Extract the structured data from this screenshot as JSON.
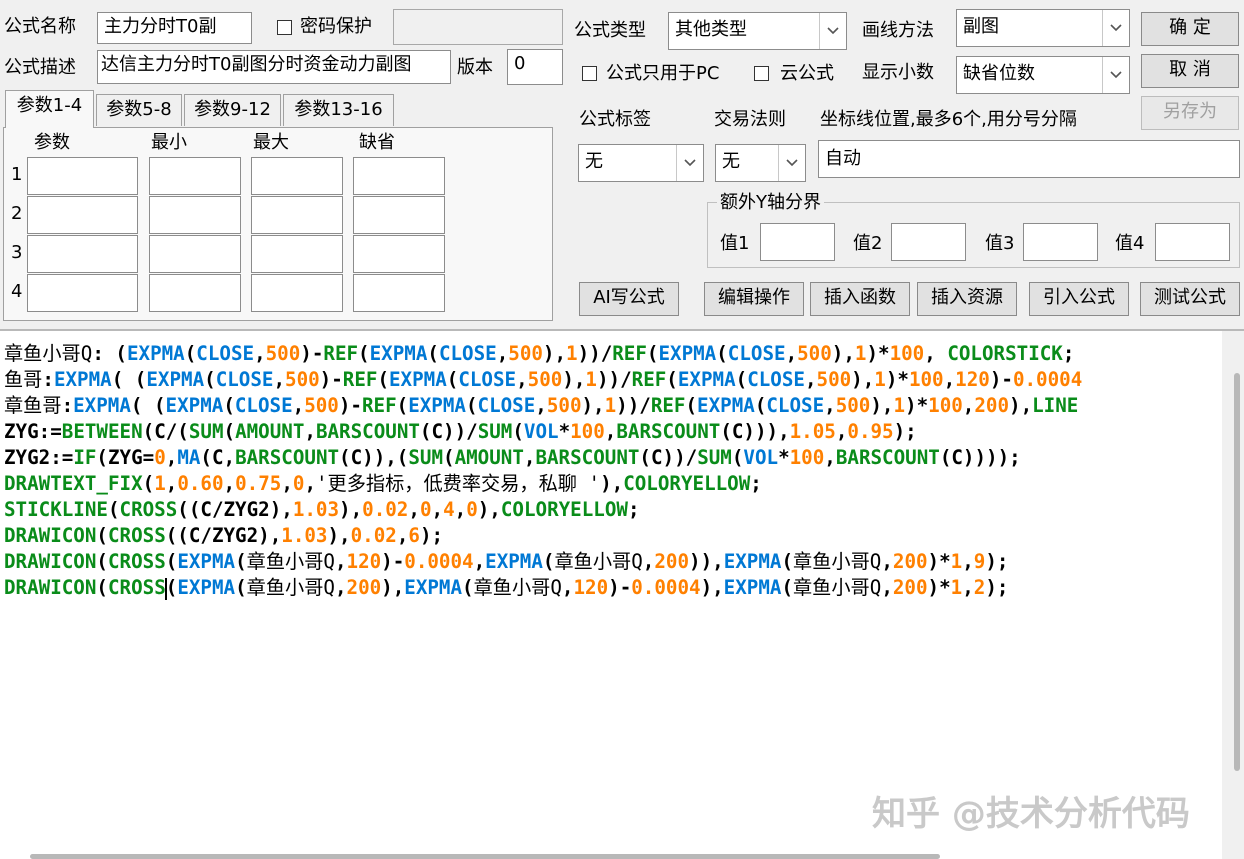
{
  "formula_name": {
    "label": "公式名称",
    "value": "主力分时T0副"
  },
  "password": {
    "label": "密码保护",
    "checked": false,
    "value": ""
  },
  "formula_desc": {
    "label": "公式描述",
    "value": "达信主力分时T0副图分时资金动力副图"
  },
  "version": {
    "label": "版本",
    "value": "0"
  },
  "formula_type": {
    "label": "公式类型",
    "value": "其他类型"
  },
  "draw_method": {
    "label": "画线方法",
    "value": "副图"
  },
  "pc_only": {
    "label": "公式只用于PC",
    "checked": false
  },
  "cloud": {
    "label": "云公式",
    "checked": false
  },
  "decimals": {
    "label": "显示小数",
    "value": "缺省位数"
  },
  "buttons": {
    "ok": "确  定",
    "cancel": "取  消",
    "save_as": "另存为"
  },
  "tabs": [
    "参数1-4",
    "参数5-8",
    "参数9-12",
    "参数13-16"
  ],
  "param_headers": [
    "参数",
    "最小",
    "最大",
    "缺省"
  ],
  "param_rows": [
    "1",
    "2",
    "3",
    "4"
  ],
  "formula_tag": {
    "label": "公式标签",
    "value": "无"
  },
  "trade_rule": {
    "label": "交易法则",
    "value": "无"
  },
  "axis_pos": {
    "label": "坐标线位置,最多6个,用分号分隔",
    "value": "自动"
  },
  "extra_y": {
    "label": "额外Y轴分界",
    "v1": "值1",
    "v2": "值2",
    "v3": "值3",
    "v4": "值4"
  },
  "actions": [
    "AI写公式",
    "编辑操作",
    "插入函数",
    "插入资源",
    "引入公式",
    "测试公式"
  ],
  "watermark": "知乎 @技术分析代码",
  "code_lines": [
    [
      [
        "c-name",
        "章鱼小哥Q"
      ],
      [
        "c-op",
        ": ("
      ],
      [
        "c-fn",
        "EXPMA"
      ],
      [
        "c-op",
        "("
      ],
      [
        "c-fn",
        "CLOSE"
      ],
      [
        "c-op",
        ","
      ],
      [
        "c-num",
        "500"
      ],
      [
        "c-op",
        ")-"
      ],
      [
        "c-kw",
        "REF"
      ],
      [
        "c-op",
        "("
      ],
      [
        "c-fn",
        "EXPMA"
      ],
      [
        "c-op",
        "("
      ],
      [
        "c-fn",
        "CLOSE"
      ],
      [
        "c-op",
        ","
      ],
      [
        "c-num",
        "500"
      ],
      [
        "c-op",
        "),"
      ],
      [
        "c-num",
        "1"
      ],
      [
        "c-op",
        "))/"
      ],
      [
        "c-kw",
        "REF"
      ],
      [
        "c-op",
        "("
      ],
      [
        "c-fn",
        "EXPMA"
      ],
      [
        "c-op",
        "("
      ],
      [
        "c-fn",
        "CLOSE"
      ],
      [
        "c-op",
        ","
      ],
      [
        "c-num",
        "500"
      ],
      [
        "c-op",
        "),"
      ],
      [
        "c-num",
        "1"
      ],
      [
        "c-op",
        ")*"
      ],
      [
        "c-num",
        "100"
      ],
      [
        "c-op",
        ", "
      ],
      [
        "c-kw",
        "COLORSTICK"
      ],
      [
        "c-op",
        ";"
      ]
    ],
    [
      [
        "c-name",
        "鱼哥"
      ],
      [
        "c-op",
        ":"
      ],
      [
        "c-fn",
        "EXPMA"
      ],
      [
        "c-op",
        "( ("
      ],
      [
        "c-fn",
        "EXPMA"
      ],
      [
        "c-op",
        "("
      ],
      [
        "c-fn",
        "CLOSE"
      ],
      [
        "c-op",
        ","
      ],
      [
        "c-num",
        "500"
      ],
      [
        "c-op",
        ")-"
      ],
      [
        "c-kw",
        "REF"
      ],
      [
        "c-op",
        "("
      ],
      [
        "c-fn",
        "EXPMA"
      ],
      [
        "c-op",
        "("
      ],
      [
        "c-fn",
        "CLOSE"
      ],
      [
        "c-op",
        ","
      ],
      [
        "c-num",
        "500"
      ],
      [
        "c-op",
        "),"
      ],
      [
        "c-num",
        "1"
      ],
      [
        "c-op",
        "))/"
      ],
      [
        "c-kw",
        "REF"
      ],
      [
        "c-op",
        "("
      ],
      [
        "c-fn",
        "EXPMA"
      ],
      [
        "c-op",
        "("
      ],
      [
        "c-fn",
        "CLOSE"
      ],
      [
        "c-op",
        ","
      ],
      [
        "c-num",
        "500"
      ],
      [
        "c-op",
        "),"
      ],
      [
        "c-num",
        "1"
      ],
      [
        "c-op",
        ")*"
      ],
      [
        "c-num",
        "100"
      ],
      [
        "c-op",
        ","
      ],
      [
        "c-num",
        "120"
      ],
      [
        "c-op",
        ")-"
      ],
      [
        "c-num",
        "0.0004"
      ]
    ],
    [
      [
        "c-name",
        "章鱼哥"
      ],
      [
        "c-op",
        ":"
      ],
      [
        "c-fn",
        "EXPMA"
      ],
      [
        "c-op",
        "( ("
      ],
      [
        "c-fn",
        "EXPMA"
      ],
      [
        "c-op",
        "("
      ],
      [
        "c-fn",
        "CLOSE"
      ],
      [
        "c-op",
        ","
      ],
      [
        "c-num",
        "500"
      ],
      [
        "c-op",
        ")-"
      ],
      [
        "c-kw",
        "REF"
      ],
      [
        "c-op",
        "("
      ],
      [
        "c-fn",
        "EXPMA"
      ],
      [
        "c-op",
        "("
      ],
      [
        "c-fn",
        "CLOSE"
      ],
      [
        "c-op",
        ","
      ],
      [
        "c-num",
        "500"
      ],
      [
        "c-op",
        "),"
      ],
      [
        "c-num",
        "1"
      ],
      [
        "c-op",
        "))/"
      ],
      [
        "c-kw",
        "REF"
      ],
      [
        "c-op",
        "("
      ],
      [
        "c-fn",
        "EXPMA"
      ],
      [
        "c-op",
        "("
      ],
      [
        "c-fn",
        "CLOSE"
      ],
      [
        "c-op",
        ","
      ],
      [
        "c-num",
        "500"
      ],
      [
        "c-op",
        "),"
      ],
      [
        "c-num",
        "1"
      ],
      [
        "c-op",
        ")*"
      ],
      [
        "c-num",
        "100"
      ],
      [
        "c-op",
        ","
      ],
      [
        "c-num",
        "200"
      ],
      [
        "c-op",
        "),"
      ],
      [
        "c-kw",
        "LINE"
      ]
    ],
    [
      [
        "c-op",
        "ZYG:="
      ],
      [
        "c-kw",
        "BETWEEN"
      ],
      [
        "c-op",
        "(C/("
      ],
      [
        "c-kw",
        "SUM"
      ],
      [
        "c-op",
        "("
      ],
      [
        "c-kw",
        "AMOUNT"
      ],
      [
        "c-op",
        ","
      ],
      [
        "c-kw",
        "BARSCOUNT"
      ],
      [
        "c-op",
        "(C))/"
      ],
      [
        "c-kw",
        "SUM"
      ],
      [
        "c-op",
        "("
      ],
      [
        "c-fn",
        "VOL"
      ],
      [
        "c-op",
        "*"
      ],
      [
        "c-num",
        "100"
      ],
      [
        "c-op",
        ","
      ],
      [
        "c-kw",
        "BARSCOUNT"
      ],
      [
        "c-op",
        "(C))),"
      ],
      [
        "c-num",
        "1.05"
      ],
      [
        "c-op",
        ","
      ],
      [
        "c-num",
        "0.95"
      ],
      [
        "c-op",
        ");"
      ]
    ],
    [
      [
        "c-op",
        "ZYG2:="
      ],
      [
        "c-kw",
        "IF"
      ],
      [
        "c-op",
        "(ZYG="
      ],
      [
        "c-num",
        "0"
      ],
      [
        "c-op",
        ","
      ],
      [
        "c-fn",
        "MA"
      ],
      [
        "c-op",
        "(C,"
      ],
      [
        "c-kw",
        "BARSCOUNT"
      ],
      [
        "c-op",
        "(C)),("
      ],
      [
        "c-kw",
        "SUM"
      ],
      [
        "c-op",
        "("
      ],
      [
        "c-kw",
        "AMOUNT"
      ],
      [
        "c-op",
        ","
      ],
      [
        "c-kw",
        "BARSCOUNT"
      ],
      [
        "c-op",
        "(C))/"
      ],
      [
        "c-kw",
        "SUM"
      ],
      [
        "c-op",
        "("
      ],
      [
        "c-fn",
        "VOL"
      ],
      [
        "c-op",
        "*"
      ],
      [
        "c-num",
        "100"
      ],
      [
        "c-op",
        ","
      ],
      [
        "c-kw",
        "BARSCOUNT"
      ],
      [
        "c-op",
        "(C))));"
      ]
    ],
    [
      [
        "c-kw",
        "DRAWTEXT_FIX"
      ],
      [
        "c-op",
        "("
      ],
      [
        "c-num",
        "1"
      ],
      [
        "c-op",
        ","
      ],
      [
        "c-num",
        "0.60"
      ],
      [
        "c-op",
        ","
      ],
      [
        "c-num",
        "0.75"
      ],
      [
        "c-op",
        ","
      ],
      [
        "c-num",
        "0"
      ],
      [
        "c-op",
        ","
      ],
      [
        "c-str",
        "'更多指标，低费率交易，私聊 '"
      ],
      [
        "c-op",
        "),"
      ],
      [
        "c-kw",
        "COLORYELLOW"
      ],
      [
        "c-op",
        ";"
      ]
    ],
    [
      [
        "c-kw",
        "STICKLINE"
      ],
      [
        "c-op",
        "("
      ],
      [
        "c-kw",
        "CROSS"
      ],
      [
        "c-op",
        "((C/ZYG2),"
      ],
      [
        "c-num",
        "1.03"
      ],
      [
        "c-op",
        "),"
      ],
      [
        "c-num",
        "0.02"
      ],
      [
        "c-op",
        ","
      ],
      [
        "c-num",
        "0"
      ],
      [
        "c-op",
        ","
      ],
      [
        "c-num",
        "4"
      ],
      [
        "c-op",
        ","
      ],
      [
        "c-num",
        "0"
      ],
      [
        "c-op",
        "),"
      ],
      [
        "c-kw",
        "COLORYELLOW"
      ],
      [
        "c-op",
        ";"
      ]
    ],
    [
      [
        "c-kw",
        "DRAWICON"
      ],
      [
        "c-op",
        "("
      ],
      [
        "c-kw",
        "CROSS"
      ],
      [
        "c-op",
        "((C/ZYG2),"
      ],
      [
        "c-num",
        "1.03"
      ],
      [
        "c-op",
        "),"
      ],
      [
        "c-num",
        "0.02"
      ],
      [
        "c-op",
        ","
      ],
      [
        "c-num",
        "6"
      ],
      [
        "c-op",
        ");"
      ]
    ],
    [
      [
        "c-kw",
        "DRAWICON"
      ],
      [
        "c-op",
        "("
      ],
      [
        "c-kw",
        "CROSS"
      ],
      [
        "c-op",
        "("
      ],
      [
        "c-fn",
        "EXPMA"
      ],
      [
        "c-op",
        "("
      ],
      [
        "c-name",
        "章鱼小哥Q"
      ],
      [
        "c-op",
        ","
      ],
      [
        "c-num",
        "120"
      ],
      [
        "c-op",
        ")-"
      ],
      [
        "c-num",
        "0.0004"
      ],
      [
        "c-op",
        ","
      ],
      [
        "c-fn",
        "EXPMA"
      ],
      [
        "c-op",
        "("
      ],
      [
        "c-name",
        "章鱼小哥Q"
      ],
      [
        "c-op",
        ","
      ],
      [
        "c-num",
        "200"
      ],
      [
        "c-op",
        "))"
      ],
      [
        "c-op",
        ","
      ],
      [
        "c-fn",
        "EXPMA"
      ],
      [
        "c-op",
        "("
      ],
      [
        "c-name",
        "章鱼小哥Q"
      ],
      [
        "c-op",
        ","
      ],
      [
        "c-num",
        "200"
      ],
      [
        "c-op",
        ")*"
      ],
      [
        "c-num",
        "1"
      ],
      [
        "c-op",
        ","
      ],
      [
        "c-num",
        "9"
      ],
      [
        "c-op",
        ");"
      ]
    ],
    [
      [
        "c-kw",
        "DRAWICON"
      ],
      [
        "c-op",
        "("
      ],
      [
        "c-kw",
        "CROSS"
      ],
      [
        "cursor",
        ""
      ],
      [
        "c-op",
        "("
      ],
      [
        "c-fn",
        "EXPMA"
      ],
      [
        "c-op",
        "("
      ],
      [
        "c-name",
        "章鱼小哥Q"
      ],
      [
        "c-op",
        ","
      ],
      [
        "c-num",
        "200"
      ],
      [
        "c-op",
        "),"
      ],
      [
        "c-fn",
        "EXPMA"
      ],
      [
        "c-op",
        "("
      ],
      [
        "c-name",
        "章鱼小哥Q"
      ],
      [
        "c-op",
        ","
      ],
      [
        "c-num",
        "120"
      ],
      [
        "c-op",
        ")-"
      ],
      [
        "c-num",
        "0.0004"
      ],
      [
        "c-op",
        "),"
      ],
      [
        "c-fn",
        "EXPMA"
      ],
      [
        "c-op",
        "("
      ],
      [
        "c-name",
        "章鱼小哥Q"
      ],
      [
        "c-op",
        ","
      ],
      [
        "c-num",
        "200"
      ],
      [
        "c-op",
        ")*"
      ],
      [
        "c-num",
        "1"
      ],
      [
        "c-op",
        ","
      ],
      [
        "c-num",
        "2"
      ],
      [
        "c-op",
        ");"
      ]
    ]
  ]
}
